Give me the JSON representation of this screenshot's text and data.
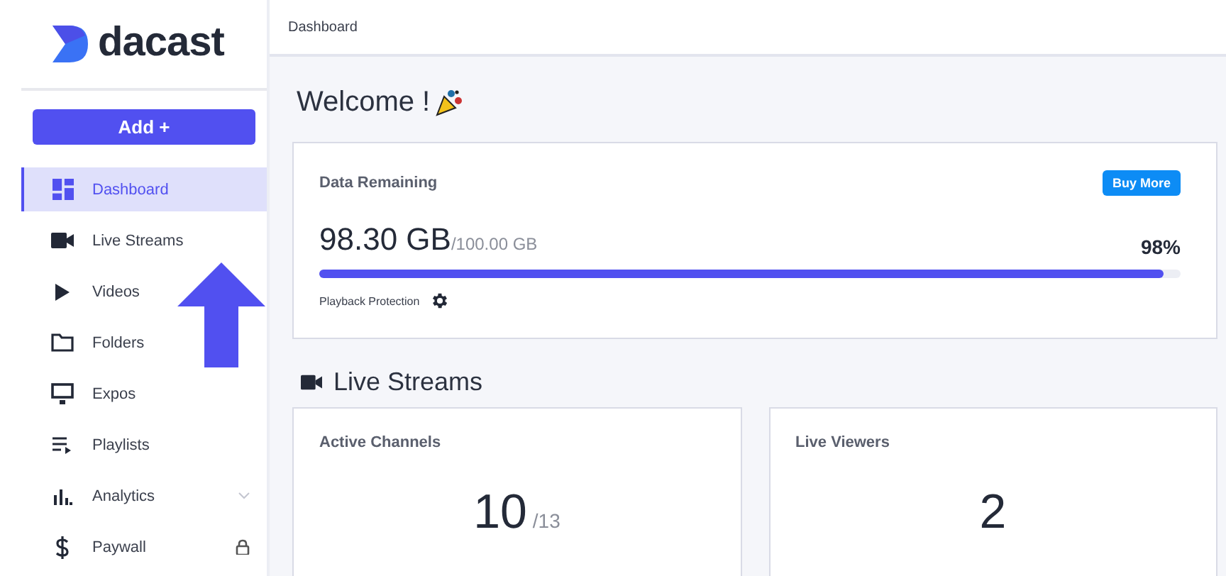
{
  "sidebar": {
    "logo": "dacast",
    "add_button": "Add +",
    "items": [
      {
        "label": "Dashboard",
        "selected": true
      },
      {
        "label": "Live Streams",
        "selected": false
      },
      {
        "label": "Videos",
        "selected": false
      },
      {
        "label": "Folders",
        "selected": false
      },
      {
        "label": "Expos",
        "selected": false
      },
      {
        "label": "Playlists",
        "selected": false
      },
      {
        "label": "Analytics",
        "selected": false
      },
      {
        "label": "Paywall",
        "selected": false
      }
    ]
  },
  "breadcrumb": "Dashboard",
  "welcome": "Welcome  !",
  "data_card": {
    "title": "Data Remaining",
    "button": "Buy More",
    "amount": "98.30 GB",
    "total": "/100.00 GB",
    "percent": "98%",
    "level": 0.98,
    "footer": "Playback Protection"
  },
  "live_streams": {
    "heading": "Live Streams",
    "cards": [
      {
        "title": "Active Channels",
        "value": "10",
        "total": "/13"
      },
      {
        "title": "Live Viewers",
        "value": "2"
      }
    ]
  }
}
